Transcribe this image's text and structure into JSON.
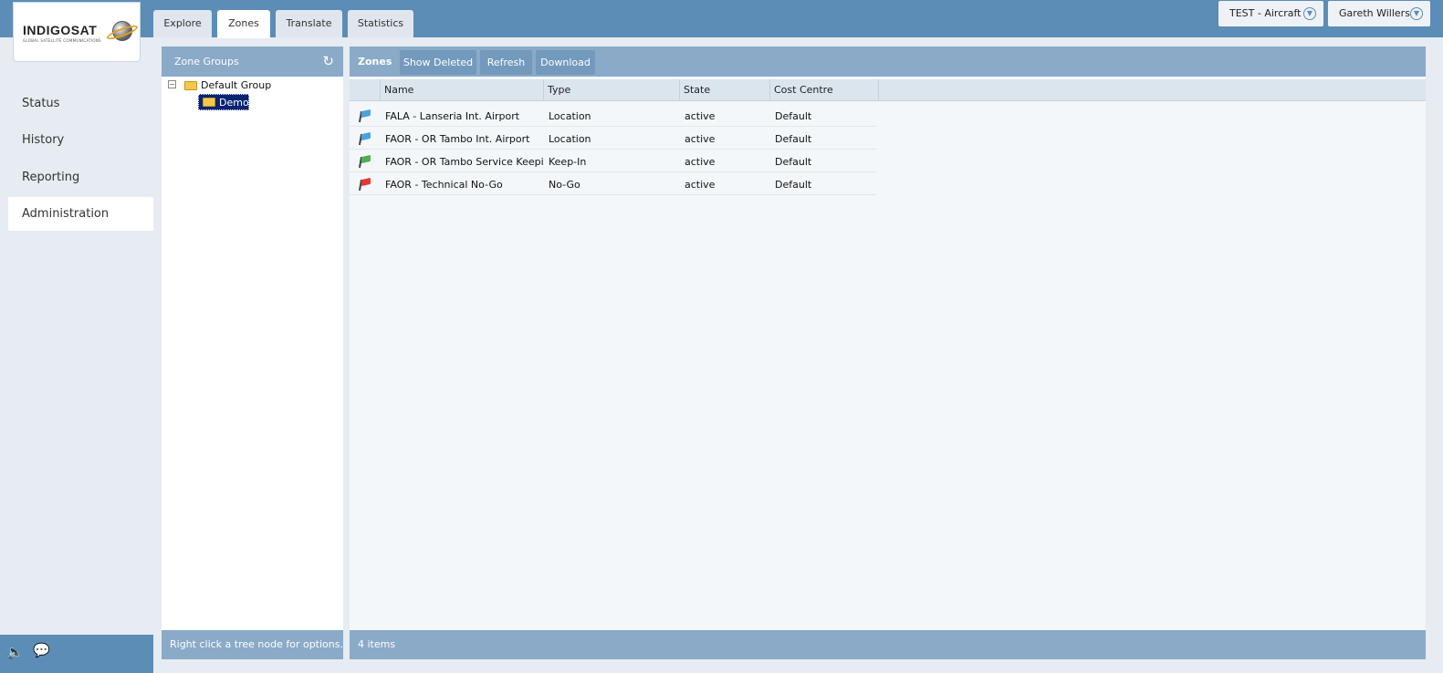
{
  "brand": {
    "name": "INDIGOSAT",
    "tagline": "GLOBAL SATELLITE COMMUNICATIONS"
  },
  "tabs": [
    {
      "label": "Explore"
    },
    {
      "label": "Zones"
    },
    {
      "label": "Translate"
    },
    {
      "label": "Statistics"
    }
  ],
  "active_tab": "Zones",
  "account_selector": {
    "value": "TEST - Aircraft"
  },
  "user_menu": {
    "value": "Gareth Willers"
  },
  "sidebar": {
    "items": [
      {
        "label": "Status"
      },
      {
        "label": "History"
      },
      {
        "label": "Reporting"
      },
      {
        "label": "Administration"
      }
    ],
    "active": "Administration"
  },
  "zone_groups": {
    "title": "Zone Groups",
    "tree": {
      "root": "Default Group",
      "children": [
        "Demo"
      ],
      "selected": "Demo"
    },
    "footer": "Right click a tree node for options."
  },
  "zones": {
    "title": "Zones",
    "toolbar": {
      "show_deleted": "Show Deleted",
      "refresh": "Refresh",
      "download": "Download"
    },
    "columns": [
      "Name",
      "Type",
      "State",
      "Cost Centre"
    ],
    "rows": [
      {
        "flag": "blue",
        "name": "FALA - Lanseria Int. Airport",
        "type": "Location",
        "state": "active",
        "cost_centre": "Default"
      },
      {
        "flag": "blue",
        "name": "FAOR - OR Tambo Int. Airport",
        "type": "Location",
        "state": "active",
        "cost_centre": "Default"
      },
      {
        "flag": "green",
        "name": "FAOR - OR Tambo Service Keepin",
        "type": "Keep-In",
        "state": "active",
        "cost_centre": "Default"
      },
      {
        "flag": "red",
        "name": "FAOR - Technical No-Go",
        "type": "No-Go",
        "state": "active",
        "cost_centre": "Default"
      }
    ],
    "item_count": "4 items"
  },
  "colors": {
    "header_blue": "#5b8db6",
    "panel_header": "#8aaac8",
    "selection": "#0a2472",
    "flag_blue": "#4aa3df",
    "flag_green": "#4caf50",
    "flag_red": "#e53935"
  },
  "icons": {
    "refresh": "refresh-icon",
    "dropdown": "chevron-down-circle-icon",
    "sound": "speaker-icon",
    "chat": "chat-bubble-icon"
  }
}
